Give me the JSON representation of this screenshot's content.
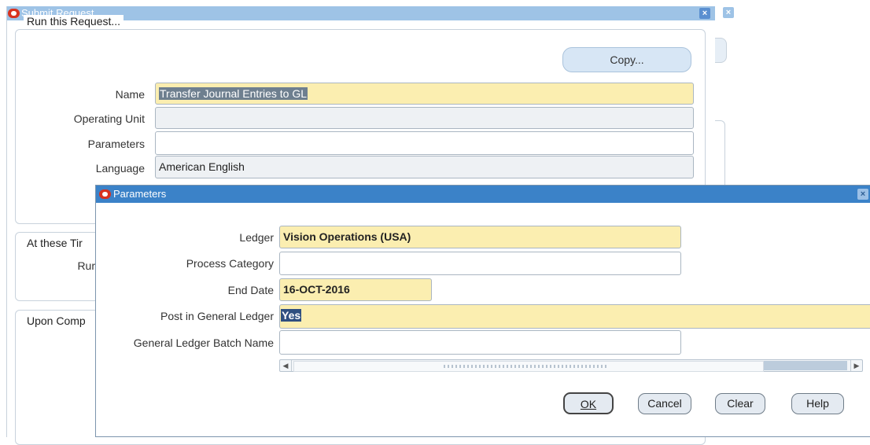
{
  "submit_window": {
    "title": "Submit Request",
    "run_group_label": "Run this Request...",
    "copy_label": "Copy...",
    "name_label": "Name",
    "name_value": "Transfer Journal Entries to GL",
    "operating_unit_label": "Operating Unit",
    "operating_unit_value": "",
    "parameters_label": "Parameters",
    "parameters_value": "",
    "language_label": "Language",
    "language_value": "American English",
    "times_group_label": "At these Tir",
    "run_label": "Rur",
    "completion_group_label": "Upon Comp"
  },
  "parameters_dialog": {
    "title": "Parameters",
    "fields": [
      {
        "label": "Ledger",
        "value": "Vision Operations (USA)"
      },
      {
        "label": "Process Category",
        "value": ""
      },
      {
        "label": "End Date",
        "value": "16-OCT-2016"
      },
      {
        "label": "Post in General Ledger",
        "value": "Yes"
      },
      {
        "label": "General Ledger Batch Name",
        "value": ""
      }
    ],
    "buttons": {
      "ok": "OK",
      "cancel": "Cancel",
      "clear": "Clear",
      "help": "Help"
    }
  },
  "colors": {
    "required_field": "#fbeeb0",
    "title_active": "#3b82c8",
    "title_inactive": "#9ec3e6",
    "selection": "#2f4f80"
  }
}
